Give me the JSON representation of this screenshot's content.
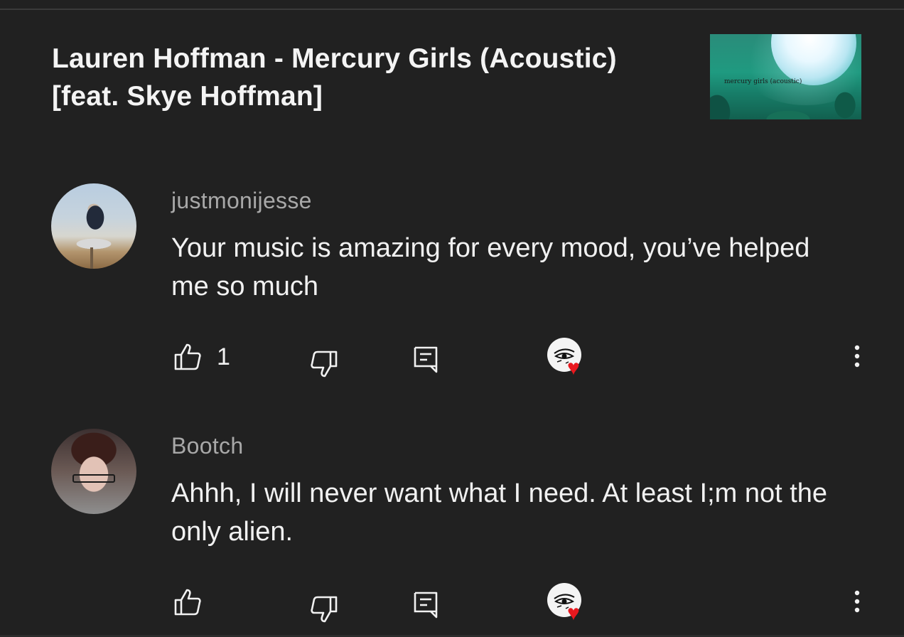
{
  "video": {
    "title": "Lauren Hoffman - Mercury Girls (Acoustic) [feat. Skye Hoffman]",
    "thumbnail_caption": "mercury girls (acoustic)"
  },
  "comments": [
    {
      "author": "justmonijesse",
      "text": "Your music is amazing for every mood, you’ve helped me so much",
      "likes": "1",
      "creator_hearted": true
    },
    {
      "author": "Bootch",
      "text": "Ahhh, I will never want what I need.  At least I;m not the only alien.",
      "likes": "",
      "creator_hearted": true
    }
  ],
  "icons": {
    "like": "thumbs-up-icon",
    "dislike": "thumbs-down-icon",
    "reply": "reply-icon",
    "creator_heart": "creator-heart-icon",
    "more": "more-vertical-icon"
  },
  "colors": {
    "background": "#212121",
    "text": "#f1f1f1",
    "author": "#a8a8a8",
    "heart": "#e8181e"
  }
}
